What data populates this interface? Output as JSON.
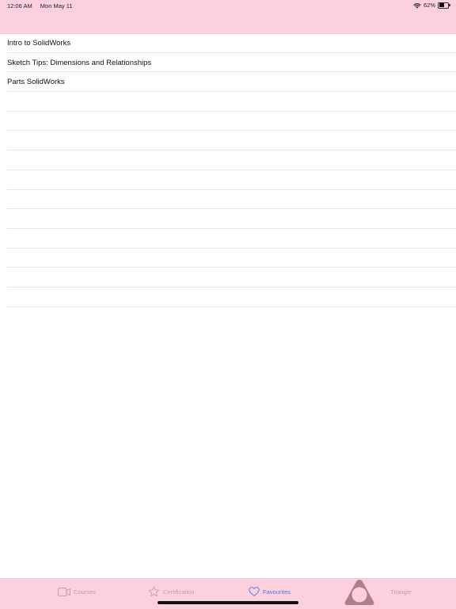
{
  "status_bar": {
    "time": "12:06 AM",
    "date": "Mon May 11",
    "battery_percent_text": "62%",
    "battery_level": 0.62
  },
  "courses": [
    {
      "title": "Intro to SolidWorks"
    },
    {
      "title": "Sketch Tips: Dimensions and Relationships"
    },
    {
      "title": "Parts SolidWorks"
    }
  ],
  "tab_bar": {
    "active_tab": "favourites",
    "tabs": [
      {
        "id": "courses",
        "label": "Courses",
        "icon": "video-camera-icon"
      },
      {
        "id": "certification",
        "label": "Certification",
        "icon": "star-icon"
      },
      {
        "id": "favourites",
        "label": "Favourites",
        "icon": "heart-icon"
      },
      {
        "id": "triangle",
        "label": "Triangle",
        "icon": "triangle-logo-icon"
      }
    ]
  },
  "colors": {
    "bar_background": "#fdd0dd",
    "active_tab": "#3b7ee8",
    "inactive_tab": "#b9a3aa",
    "logo": "#b07d8b",
    "separator": "#e6e6e6"
  }
}
